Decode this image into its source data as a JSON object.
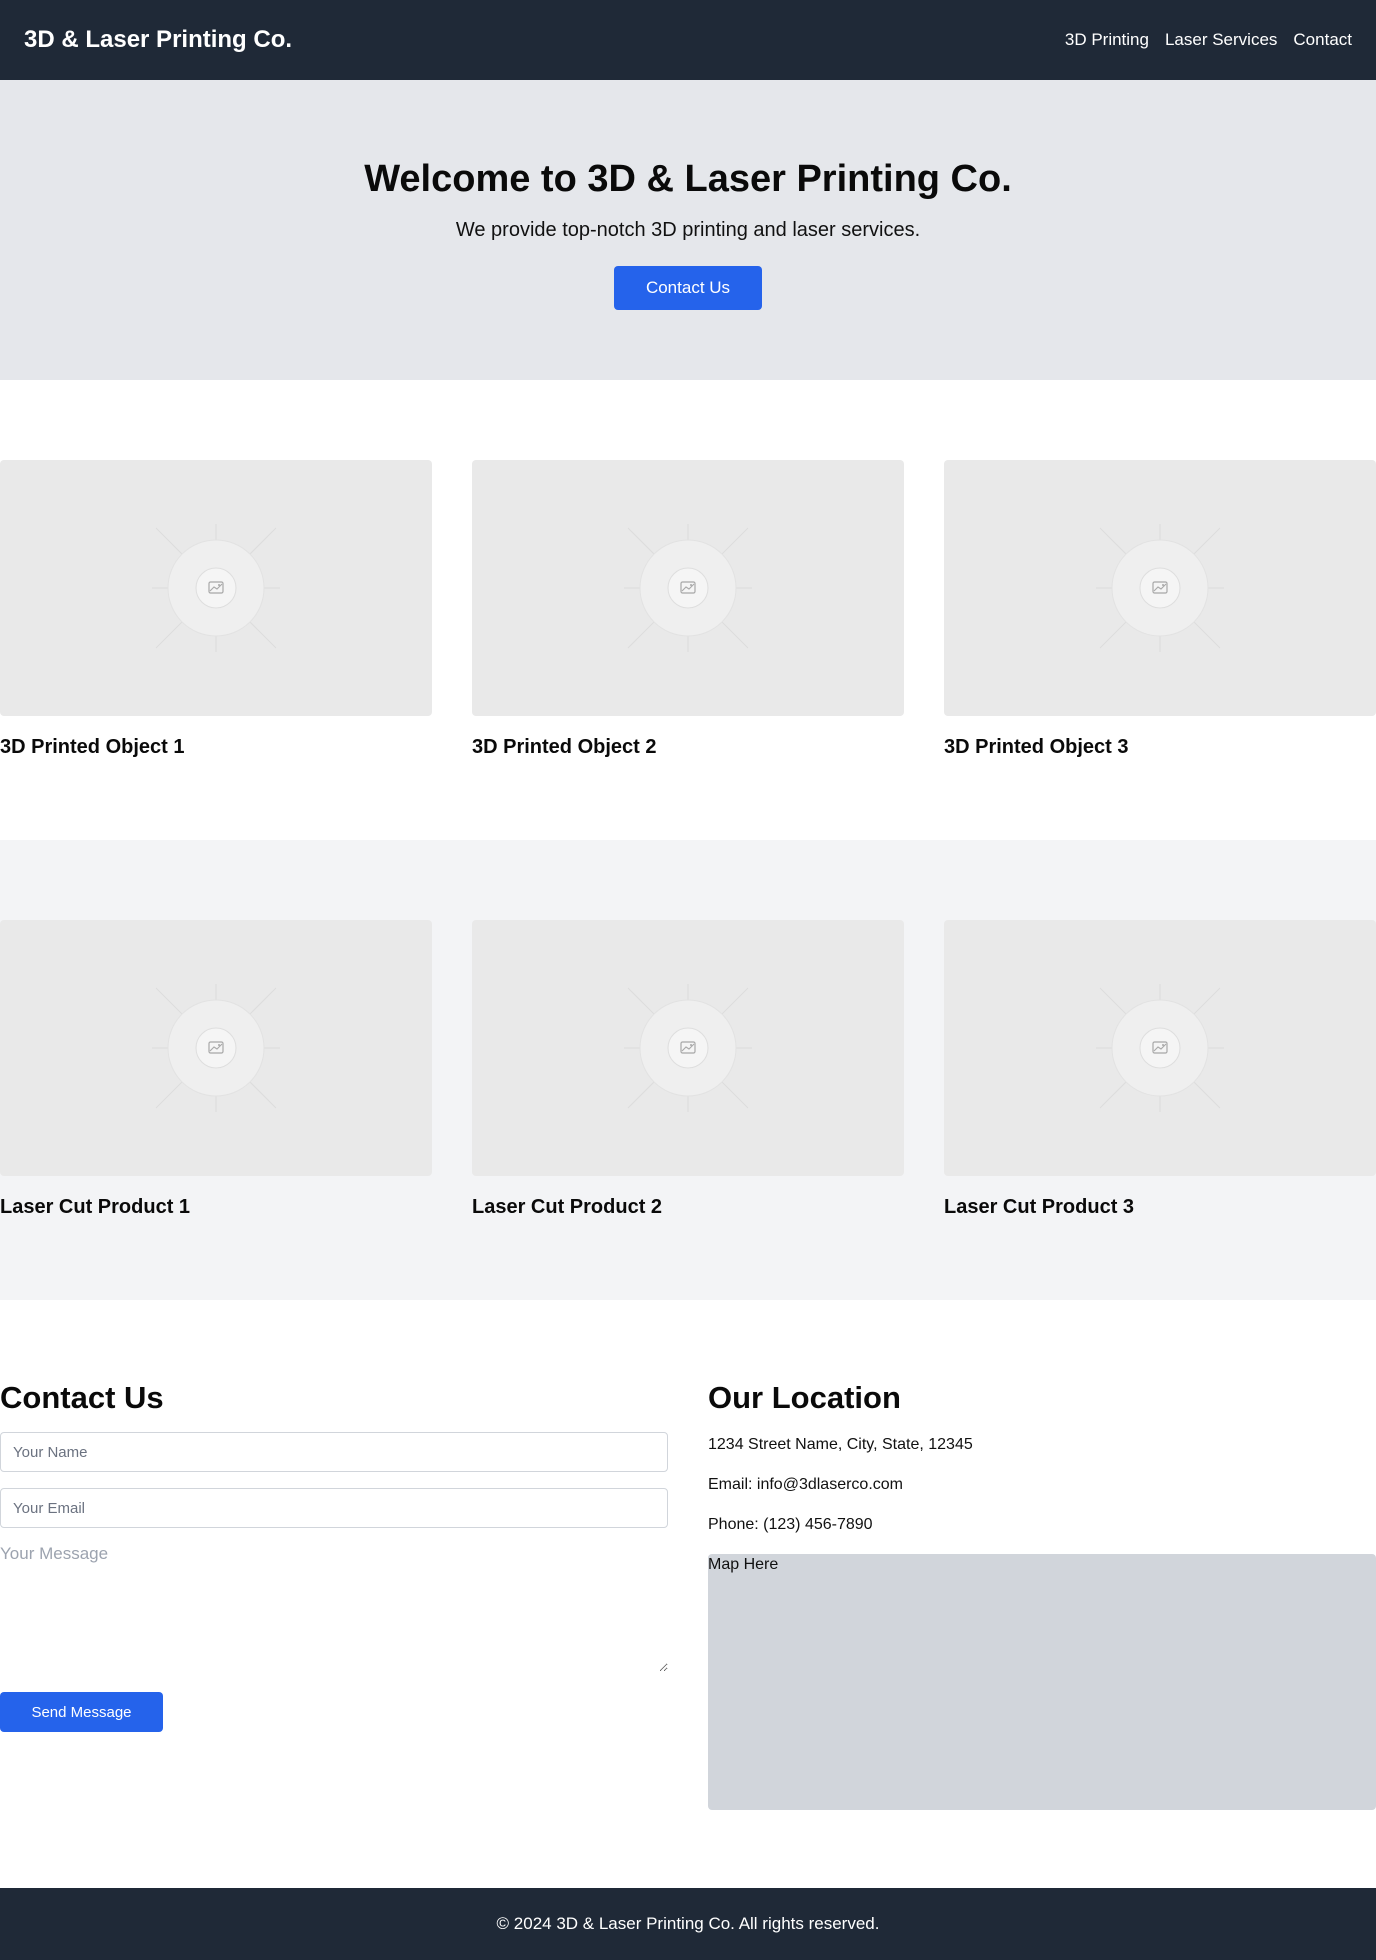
{
  "header": {
    "brand": "3D & Laser Printing Co.",
    "nav": [
      {
        "label": "3D Printing"
      },
      {
        "label": "Laser Services"
      },
      {
        "label": "Contact"
      }
    ]
  },
  "hero": {
    "title": "Welcome to 3D & Laser Printing Co.",
    "subtitle": "We provide top-notch 3D printing and laser services.",
    "cta": "Contact Us"
  },
  "printing_gallery": {
    "items": [
      {
        "title": "3D Printed Object 1",
        "icon": "image-placeholder-icon"
      },
      {
        "title": "3D Printed Object 2",
        "icon": "image-placeholder-icon"
      },
      {
        "title": "3D Printed Object 3",
        "icon": "image-placeholder-icon"
      }
    ]
  },
  "laser_gallery": {
    "items": [
      {
        "title": "Laser Cut Product 1",
        "icon": "image-placeholder-icon"
      },
      {
        "title": "Laser Cut Product 2",
        "icon": "image-placeholder-icon"
      },
      {
        "title": "Laser Cut Product 3",
        "icon": "image-placeholder-icon"
      }
    ]
  },
  "contact": {
    "title": "Contact Us",
    "name_placeholder": "Your Name",
    "email_placeholder": "Your Email",
    "message_placeholder": "Your Message",
    "submit": "Send Message"
  },
  "location": {
    "title": "Our Location",
    "address": "1234 Street Name, City, State, 12345",
    "email": "Email: info@3dlaserco.com",
    "phone": "Phone: (123) 456-7890",
    "map_label": "Map Here"
  },
  "footer": {
    "text": "© 2024 3D & Laser Printing Co. All rights reserved."
  },
  "colors": {
    "navbar": "#1f2937",
    "hero_bg": "#e5e7eb",
    "accent": "#2563eb",
    "alt_section": "#f3f4f6",
    "map_bg": "#d1d5db"
  }
}
